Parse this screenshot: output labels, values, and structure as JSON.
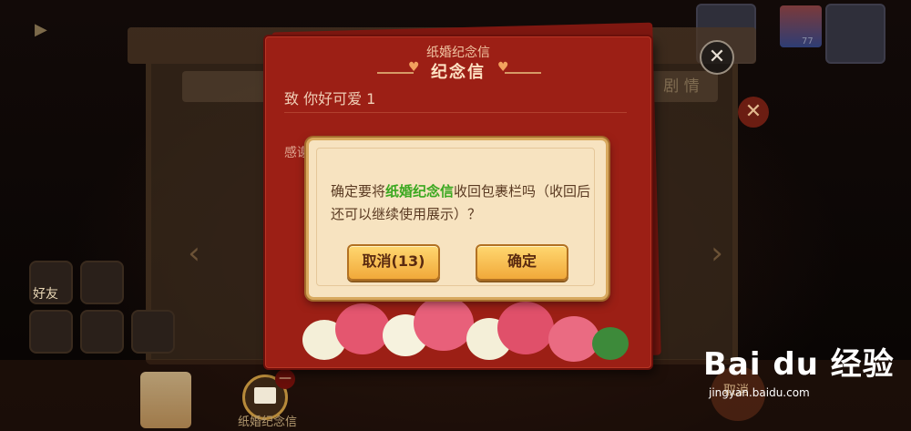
{
  "letter": {
    "header_small": "纸婚纪念信",
    "header": "纪念信",
    "greeting": "致 你好可爱 1",
    "body_snippet": "感谢"
  },
  "dialog": {
    "text_before": "确定要将",
    "item_highlight": "纸婚纪念信",
    "text_after": "收回包裹栏吗（收回后还可以继续使用展示）？",
    "cancel_label": "取消(13)",
    "confirm_label": "确定",
    "highlight_color": "#3aa81f"
  },
  "background": {
    "left_tab_label": "",
    "right_tab_label": "剧 情",
    "friend_label": "好友",
    "bottom_item_label": "纸婚纪念信",
    "bottom_cancel_label": "取消",
    "bottom_badge": "—",
    "level_text": "77"
  },
  "watermark": {
    "logo_text": "Bai du 经验",
    "url": "jingyan.baidu.com"
  }
}
